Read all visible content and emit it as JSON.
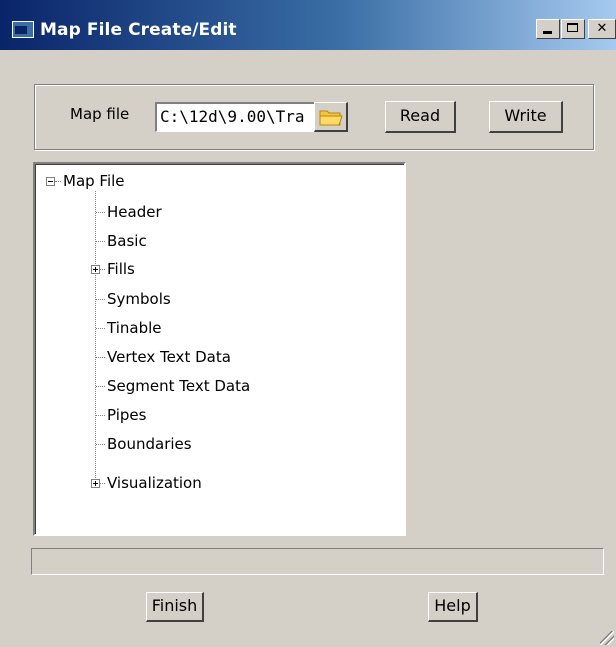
{
  "window": {
    "title": "Map File Create/Edit"
  },
  "mapfile": {
    "label": "Map file",
    "value": "C:\\12d\\9.00\\Tra",
    "read_label": "Read",
    "write_label": "Write"
  },
  "tree": {
    "root": "Map File",
    "items": [
      {
        "label": "Header",
        "expandable": false
      },
      {
        "label": "Basic",
        "expandable": false
      },
      {
        "label": "Fills",
        "expandable": true
      },
      {
        "label": "Symbols",
        "expandable": false
      },
      {
        "label": "Tinable",
        "expandable": false
      },
      {
        "label": "Vertex Text Data",
        "expandable": false
      },
      {
        "label": "Segment Text Data",
        "expandable": false
      },
      {
        "label": "Pipes",
        "expandable": false
      },
      {
        "label": "Boundaries",
        "expandable": false
      },
      {
        "label": "Visualization",
        "expandable": true
      }
    ]
  },
  "status": {
    "text": ""
  },
  "footer": {
    "finish_label": "Finish",
    "help_label": "Help"
  },
  "icons": {
    "app": "app-window-icon",
    "folder": "folder-icon"
  },
  "colors": {
    "titlebar_start": "#0a246a",
    "titlebar_end": "#a6caf0",
    "face": "#d4d0c8"
  }
}
